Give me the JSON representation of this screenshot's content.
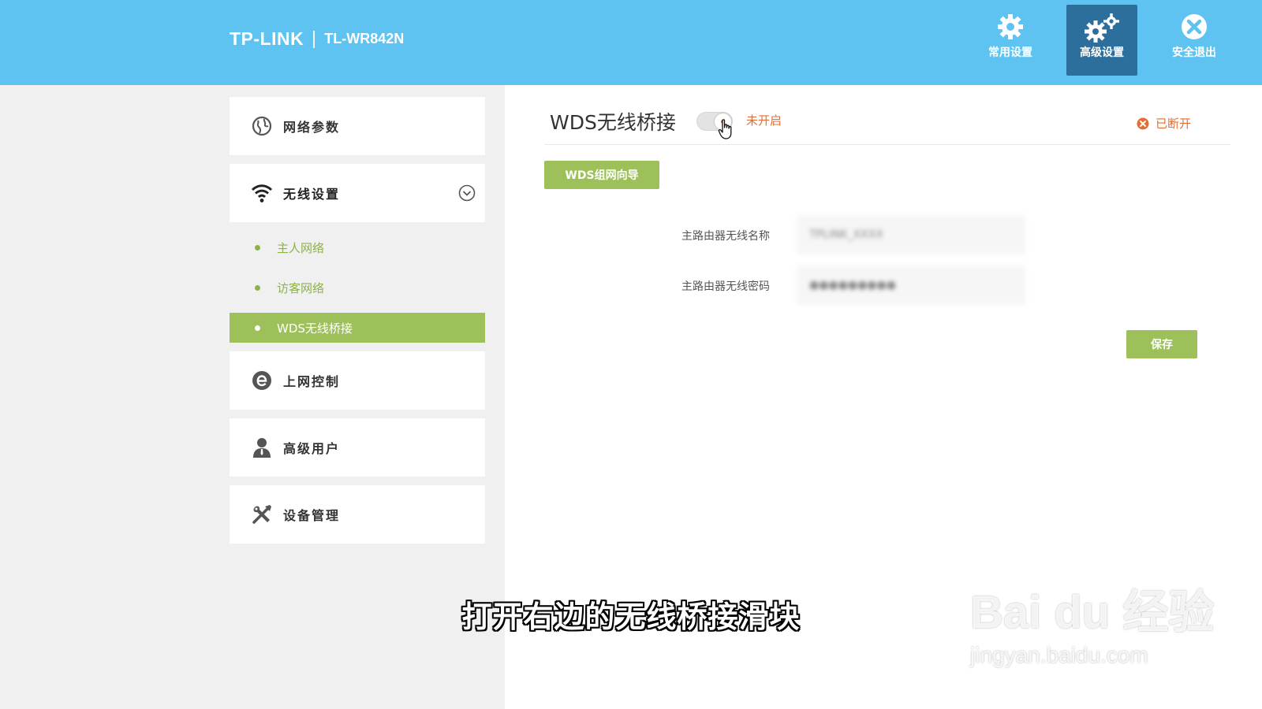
{
  "header": {
    "logo": "TP-LINK",
    "model": "TL-WR842N",
    "nav": [
      {
        "label": "常用设置",
        "icon": "gear-icon"
      },
      {
        "label": "高级设置",
        "icon": "gears-icon"
      },
      {
        "label": "安全退出",
        "icon": "close-circle-icon"
      }
    ]
  },
  "sidebar": {
    "items": [
      {
        "label": "网络参数",
        "icon": "globe-icon"
      },
      {
        "label": "无线设置",
        "icon": "wifi-icon"
      },
      {
        "label": "上网控制",
        "icon": "e-icon"
      },
      {
        "label": "高级用户",
        "icon": "user-icon"
      },
      {
        "label": "设备管理",
        "icon": "tools-icon"
      }
    ],
    "subitems": [
      {
        "label": "主人网络"
      },
      {
        "label": "访客网络"
      },
      {
        "label": "WDS无线桥接",
        "active": true
      }
    ]
  },
  "main": {
    "title": "WDS无线桥接",
    "toggle_status": "未开启",
    "connection_status": "已断开",
    "wizard_button": "WDS组网向导",
    "fields": [
      {
        "label": "主路由器无线名称",
        "value": "TPLINK_XXXX"
      },
      {
        "label": "主路由器无线密码",
        "value": "●●●●●●●●●"
      }
    ],
    "save_button": "保存"
  },
  "overlay": {
    "subtitle": "打开右边的无线桥接滑块",
    "watermark_main": "Bai du 经验",
    "watermark_sub": "jingyan.baidu.com"
  },
  "colors": {
    "header_bg": "#5fc3f2",
    "active_nav_bg": "#2d6f9c",
    "accent_green": "#9dc05a",
    "warning_orange": "#e36e34"
  }
}
